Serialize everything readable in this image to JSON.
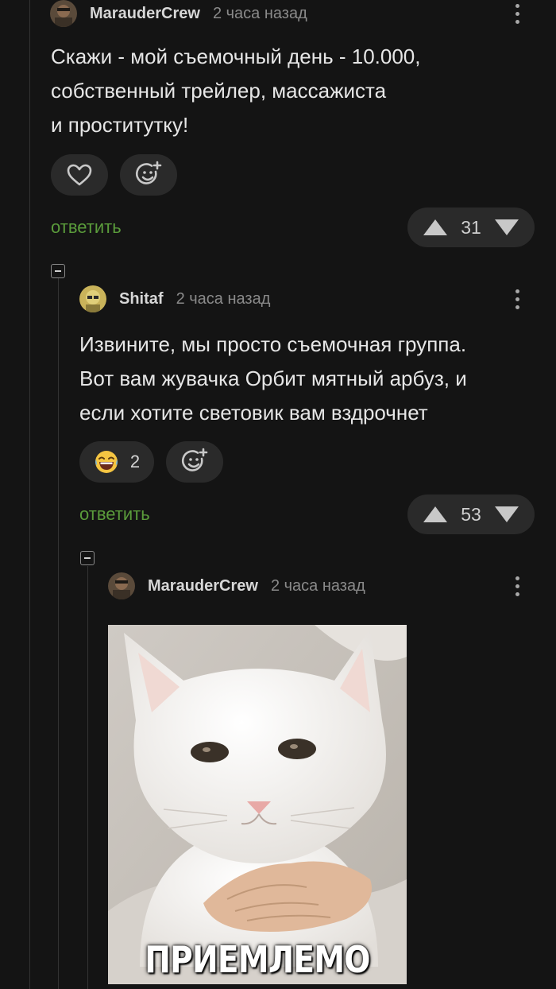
{
  "comments": [
    {
      "author": "MarauderCrew",
      "time": "2 часа назад",
      "text": "Скажи - мой съемочный день - 10.000,\nсобственный трейлер, массажиста\nи проститутку!",
      "reply_label": "ответить",
      "score": "31"
    },
    {
      "author": "Shitaf",
      "time": "2 часа назад",
      "text": "Извините, мы просто съемочная группа.\nВот вам жувачка Орбит мятный арбуз, и\nесли хотите световик вам вздрочнет",
      "reaction_count": "2",
      "reply_label": "ответить",
      "score": "53"
    },
    {
      "author": "MarauderCrew",
      "time": "2 часа назад",
      "image_caption": "ПРИЕМЛЕМО"
    }
  ],
  "icons": {
    "like": "heart-icon",
    "add_reaction": "add-reaction-icon",
    "reaction": "laughing-emoji-icon",
    "upvote": "triangle-up-icon",
    "downvote": "triangle-down-icon",
    "menu": "kebab-menu-icon",
    "collapse": "collapse-icon"
  },
  "colors": {
    "background": "#141414",
    "accent_reply": "#5a9b3b",
    "pill": "#2a2a2a"
  }
}
